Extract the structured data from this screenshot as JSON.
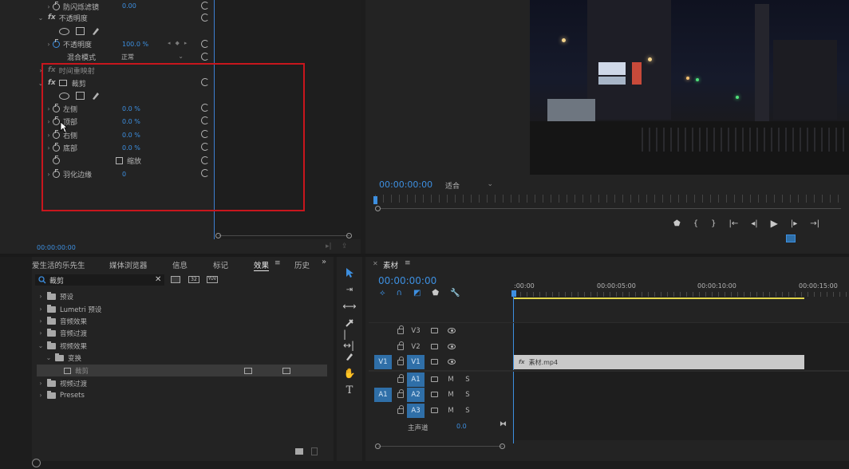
{
  "effect_controls": {
    "rows": [
      {
        "label": "防闪烁滤镜",
        "value": "0.00"
      },
      {
        "label": "不透明度"
      },
      {
        "label": "不透明度",
        "value": "100.0 %"
      },
      {
        "label": "混合模式",
        "value": "正常"
      },
      {
        "label": "时间重映射"
      },
      {
        "label": "裁剪"
      },
      {
        "label": "左侧",
        "value": "0.0 %"
      },
      {
        "label": "顶部",
        "value": "0.0 %"
      },
      {
        "label": "右侧",
        "value": "0.0 %"
      },
      {
        "label": "底部",
        "value": "0.0 %"
      },
      {
        "label": "缩放"
      },
      {
        "label": "羽化边缘",
        "value": "0"
      }
    ],
    "fx_symbol": "fx",
    "timecode": "00:00:00:00"
  },
  "program_monitor": {
    "timecode": "00:00:00:00",
    "fit": "适合"
  },
  "effects_panel": {
    "tabs": [
      "爱生活的乐先生",
      "媒体浏览器",
      "信息",
      "标记",
      "效果",
      "历史"
    ],
    "search_value": "裁剪",
    "badges": [
      "32",
      "YUV"
    ],
    "tree": [
      "预设",
      "Lumetri 预设",
      "音频效果",
      "音频过渡",
      "视频效果",
      "变换",
      "裁剪",
      "视频过渡",
      "Presets"
    ]
  },
  "timeline": {
    "tab": "素材",
    "timecode": "00:00:00:00",
    "ruler": [
      ":00:00",
      "00:00:05:00",
      "00:00:10:00",
      "00:00:15:00"
    ],
    "tracks": {
      "v3": "V3",
      "v2": "V2",
      "v1": "V1",
      "v1_source": "V1",
      "a1": "A1",
      "a1_source": "A1",
      "a2": "A2",
      "a3": "A3",
      "m": "M",
      "s": "S",
      "master": "主声道",
      "master_value": "0.0"
    },
    "clip_name": "素材.mp4",
    "clip_fx": "fx"
  },
  "colors": {
    "accent": "#3d8fe0",
    "highlight": "#c8161d",
    "track_blue": "#2f6fa8",
    "clip": "#c9c9c9",
    "work_area": "#e0d44a"
  }
}
